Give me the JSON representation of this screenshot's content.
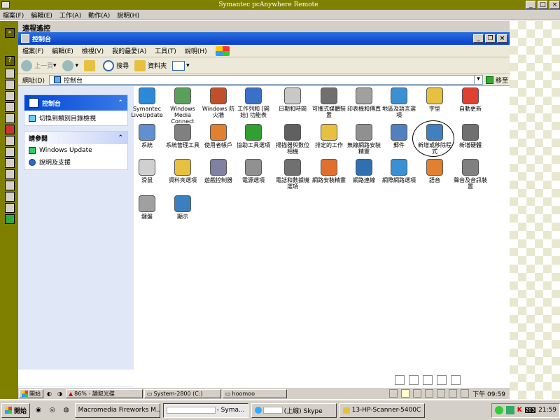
{
  "outer": {
    "title": "Symantec pcAnywhere Remote",
    "menu": [
      "檔案(F)",
      "編輯(E)",
      "工作(A)",
      "動作(A)",
      "說明(H)"
    ],
    "session_label": "遠程遙控"
  },
  "window": {
    "title": "控制台",
    "menu": [
      "檔案(F)",
      "編輯(E)",
      "檢視(V)",
      "我的最愛(A)",
      "工具(T)",
      "說明(H)"
    ],
    "toolbar": {
      "back": "上一頁",
      "search": "搜尋",
      "folders": "資料夾"
    },
    "address_label": "網址(D)",
    "address_value": "控制台",
    "go_label": "移至"
  },
  "taskpane": {
    "control_panel": {
      "title": "控制台",
      "link": "切換到類別目錄檢視"
    },
    "see_also": {
      "title": "請參閱",
      "links": [
        "Windows Update",
        "說明及支援"
      ]
    }
  },
  "icons": [
    {
      "label": "Symantec LiveUpdate",
      "color": "#2a8ad8"
    },
    {
      "label": "Windows Media Connect",
      "color": "#5aa05a"
    },
    {
      "label": "Windows 防火牆",
      "color": "#c0502a"
    },
    {
      "label": "工作列和 [開始] 功能表",
      "color": "#3a70c8"
    },
    {
      "label": "日期和時間",
      "color": "#c8c8c8"
    },
    {
      "label": "可攜式媒體裝置",
      "color": "#707070"
    },
    {
      "label": "印表機和傳真",
      "color": "#a0a0a0"
    },
    {
      "label": "地區及語言選項",
      "color": "#3a90d0"
    },
    {
      "label": "字型",
      "color": "#e8c040"
    },
    {
      "label": "自動更新",
      "color": "#e04030"
    },
    {
      "label": "系統",
      "color": "#6090d0"
    },
    {
      "label": "系統管理工具",
      "color": "#808080"
    },
    {
      "label": "使用者帳戶",
      "color": "#e08030"
    },
    {
      "label": "協助工具選項",
      "color": "#30a030"
    },
    {
      "label": "掃描器與數位相機",
      "color": "#606060"
    },
    {
      "label": "排定的工作",
      "color": "#e8c040"
    },
    {
      "label": "無線網路安裝精靈",
      "color": "#909090"
    },
    {
      "label": "郵件",
      "color": "#5080c0"
    },
    {
      "label": "新增或移除程式",
      "color": "#4080c0"
    },
    {
      "label": "新增硬體",
      "color": "#707070"
    },
    {
      "label": "滑鼠",
      "color": "#d0d0d0"
    },
    {
      "label": "資料夾選項",
      "color": "#e8c040"
    },
    {
      "label": "遊戲控制器",
      "color": "#8080a0"
    },
    {
      "label": "電源選項",
      "color": "#909090"
    },
    {
      "label": "電話和數據機選項",
      "color": "#707070"
    },
    {
      "label": "網路安裝精靈",
      "color": "#e07030"
    },
    {
      "label": "網路連線",
      "color": "#3070b0"
    },
    {
      "label": "網際網路選項",
      "color": "#3a90d0"
    },
    {
      "label": "語音",
      "color": "#e08030"
    },
    {
      "label": "聲音及音訊裝置",
      "color": "#808080"
    },
    {
      "label": "鍵盤",
      "color": "#a0a0a0"
    },
    {
      "label": "顯示",
      "color": "#3a80c0"
    }
  ],
  "remote_taskbar": {
    "start": "開始",
    "items": [
      "86% - 讀取光碟",
      "System-2800 (C:)",
      "hoomoo"
    ],
    "clock": "下午 09:59"
  },
  "host_taskbar": {
    "start": "開始",
    "items": [
      "Macromedia Fireworks M...",
      "- Syma...",
      "(上線) Skype",
      "13-HP-Scanner-5400C"
    ],
    "clock": "21:59",
    "tray_badge": "K",
    "tray_num": "203"
  }
}
